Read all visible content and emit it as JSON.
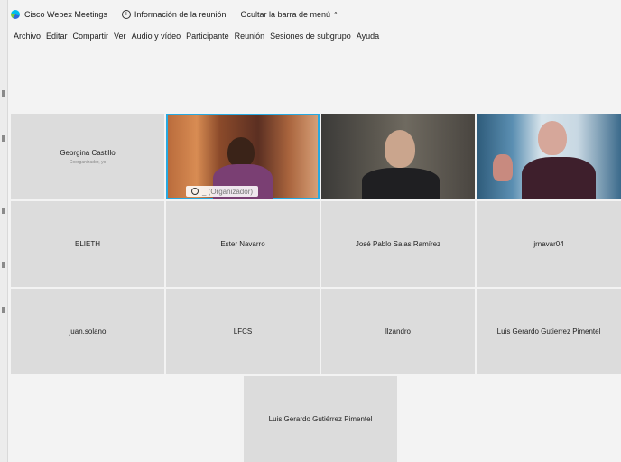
{
  "titlebar": {
    "app_name": "Cisco Webex Meetings",
    "meeting_info": "Información de la reunión",
    "hide_menu": "Ocultar la barra de menú",
    "hide_menu_chevron": "^"
  },
  "menu": [
    "Archivo",
    "Editar",
    "Compartir",
    "Ver",
    "Audio y vídeo",
    "Participante",
    "Reunión",
    "Sesiones de subgrupo",
    "Ayuda"
  ],
  "participants": {
    "row1": {
      "first": {
        "name": "Georgina Castillo",
        "role": "Coorganizador, yo"
      },
      "video_label": "_ (Organizador)"
    },
    "row2": [
      "ELIETH",
      "Ester Navarro",
      "José Pablo Salas Ramírez",
      "jrnavar04"
    ],
    "row3": [
      "juan.solano",
      "LFCS",
      "llzandro",
      "Luis Gerardo Gutierrez Pimentel"
    ],
    "row4": [
      "Luis Gerardo Gutiérrez Pimentel"
    ]
  },
  "colors": {
    "active_border": "#27a9e1",
    "tile": "#dcdcdc",
    "background": "#f3f3f3"
  },
  "icons": {
    "app": "webex-logo-icon",
    "info": "info-icon",
    "chevron": "chevron-up-icon",
    "mic": "microphone-icon"
  }
}
